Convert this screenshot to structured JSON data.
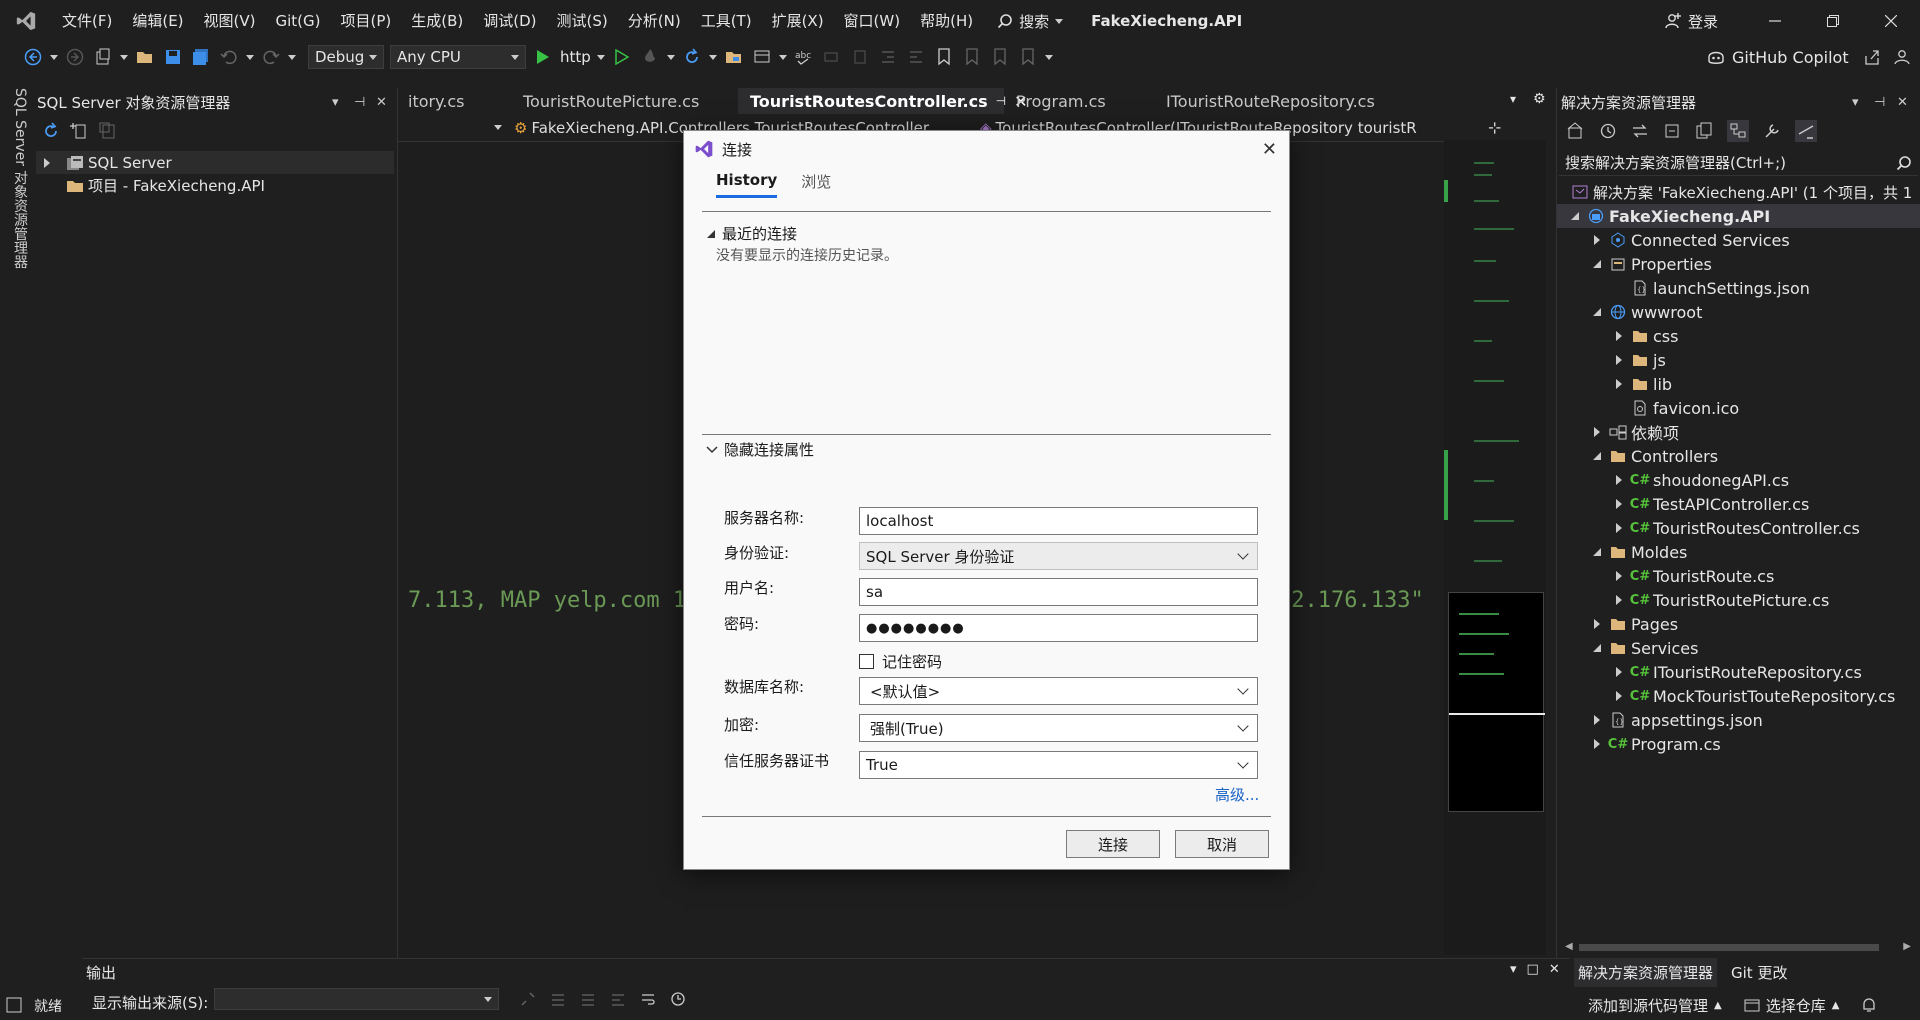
{
  "menubar": {
    "items": [
      "文件(F)",
      "编辑(E)",
      "视图(V)",
      "Git(G)",
      "项目(P)",
      "生成(B)",
      "调试(D)",
      "测试(S)",
      "分析(N)",
      "工具(T)",
      "扩展(X)",
      "窗口(W)",
      "帮助(H)"
    ],
    "search_label": "搜索",
    "app_title": "FakeXiecheng.API",
    "login_label": "登录"
  },
  "toolbar": {
    "configuration": "Debug",
    "platform": "Any CPU",
    "run_target": "http",
    "copilot_label": "GitHub Copilot"
  },
  "left_strip": {
    "label": "SQL Server 对象资源管理器"
  },
  "sql_explorer": {
    "title": "SQL Server 对象资源管理器",
    "nodes": [
      {
        "label": "SQL Server"
      },
      {
        "label": "项目 - FakeXiecheng.API"
      }
    ]
  },
  "editor": {
    "tabs": [
      {
        "label": "itory.cs"
      },
      {
        "label": "TouristRoutePicture.cs"
      },
      {
        "label": "TouristRoutesController.cs"
      },
      {
        "label": "Program.cs"
      },
      {
        "label": "ITouristRouteRepository.cs"
      }
    ],
    "nav_left": "FakeXiecheng.API.Controllers.TouristRoutesController",
    "nav_right": "TouristRoutesController(ITouristRouteRepository touristR",
    "code_left": "7.113, MAP yelp.com 1",
    "code_right": "32.176.133\""
  },
  "solution_explorer": {
    "title": "解决方案资源管理器",
    "search_placeholder": "搜索解决方案资源管理器(Ctrl+;)",
    "rows": [
      {
        "label": "解决方案 'FakeXiecheng.API' (1 个项目，共 1"
      },
      {
        "label": "FakeXiecheng.API"
      },
      {
        "label": "Connected Services"
      },
      {
        "label": "Properties"
      },
      {
        "label": "launchSettings.json"
      },
      {
        "label": "wwwroot"
      },
      {
        "label": "css"
      },
      {
        "label": "js"
      },
      {
        "label": "lib"
      },
      {
        "label": "favicon.ico"
      },
      {
        "label": "依赖项"
      },
      {
        "label": "Controllers"
      },
      {
        "label": "shoudonegAPI.cs"
      },
      {
        "label": "TestAPIController.cs"
      },
      {
        "label": "TouristRoutesController.cs"
      },
      {
        "label": "Moldes"
      },
      {
        "label": "TouristRoute.cs"
      },
      {
        "label": "TouristRoutePicture.cs"
      },
      {
        "label": "Pages"
      },
      {
        "label": "Services"
      },
      {
        "label": "ITouristRouteRepository.cs"
      },
      {
        "label": "MockTouristTouteRepository.cs"
      },
      {
        "label": "appsettings.json"
      },
      {
        "label": "Program.cs"
      }
    ],
    "bottom_tabs": [
      "解决方案资源管理器",
      "Git 更改"
    ],
    "cs_badge": "C#"
  },
  "output_panel": {
    "title": "输出",
    "source_label": "显示输出来源(S):"
  },
  "statusbar": {
    "ready": "就绪",
    "add_source": "添加到源代码管理",
    "select_repo": "选择仓库"
  },
  "dialog": {
    "title": "连接",
    "tabs": [
      "History",
      "浏览"
    ],
    "recent_header": "最近的连接",
    "no_history": "没有要显示的连接历史记录。",
    "props_header": "隐藏连接属性",
    "fields": {
      "server_label": "服务器名称:",
      "server_value": "localhost",
      "auth_label": "身份验证:",
      "auth_value": "SQL Server 身份验证",
      "user_label": "用户名:",
      "user_value": "sa",
      "password_label": "密码:",
      "password_value": "●●●●●●●●",
      "remember_label": "记住密码",
      "db_label": "数据库名称:",
      "db_value": "<默认值>",
      "encrypt_label": "加密:",
      "encrypt_value": "强制(True)",
      "trust_label": "信任服务器证书",
      "trust_value": "True"
    },
    "advanced_link": "高级...",
    "connect_button": "连接",
    "cancel_button": "取消"
  }
}
